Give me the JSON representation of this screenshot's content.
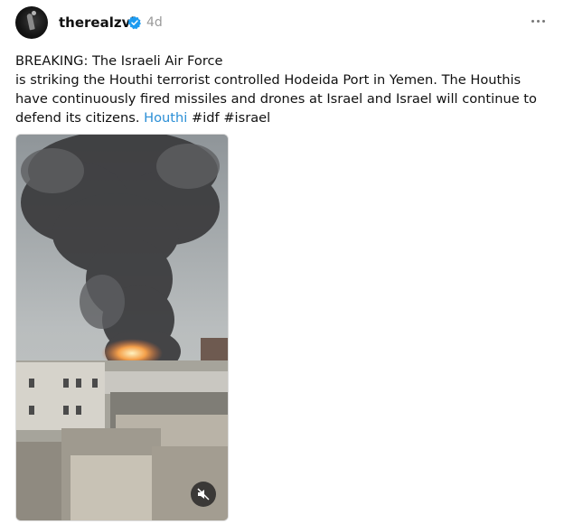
{
  "post": {
    "username": "therealzvi",
    "time_ago": "4d",
    "text_line1": "BREAKING: The Israeli Air Force",
    "text_body": "is striking the Houthi terrorist controlled Hodeida Port in Yemen. The Houthis have continuously fired missiles and drones at Israel and Israel will continue to defend its citizens.",
    "link_text": "Houthi",
    "hashtags": [
      "#idf",
      "#israel"
    ]
  },
  "icons": {
    "verified": "verified-badge-icon",
    "more": "more-options-icon",
    "mute": "muted-speaker-icon"
  },
  "colors": {
    "link": "#2b8fd6",
    "verified": "#1d9bf0",
    "muted_text": "#9a9a9a"
  }
}
